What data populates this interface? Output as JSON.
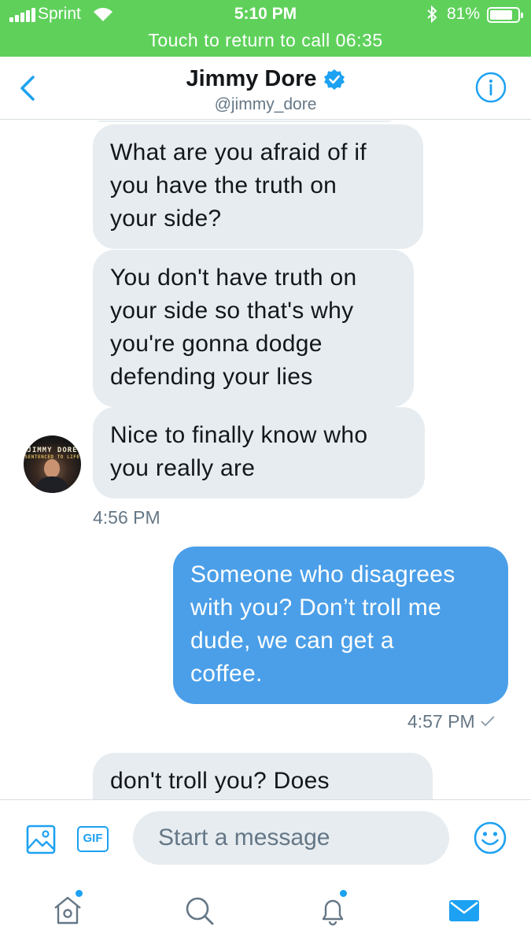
{
  "status_bar": {
    "carrier": "Sprint",
    "time": "5:10 PM",
    "battery_percent": "81%",
    "battery_level": 0.81,
    "call_banner": "Touch to return to call 06:35",
    "background_color": "#5fd15b"
  },
  "header": {
    "display_name": "Jimmy Dore",
    "handle": "@jimmy_dore",
    "verified": true,
    "accent_color": "#1da1f2"
  },
  "conversation": {
    "incoming": [
      {
        "lines": [
          "What are you afraid of if",
          "you have the truth on",
          "your side?"
        ]
      },
      {
        "lines": [
          "You don't have truth on",
          "your side so that's why",
          "you're gonna dodge",
          "defending your lies"
        ]
      },
      {
        "lines": [
          "Nice to finally know who",
          "you really are"
        ]
      }
    ],
    "avatar_text": "JIMMY DORE",
    "avatar_subtext": "SENTENCED TO LIFE",
    "incoming_timestamp": "4:56 PM",
    "outgoing": {
      "lines": [
        "Someone who disagrees",
        "with you? Don’t troll me",
        "dude, we can get a",
        "coffee."
      ],
      "timestamp": "4:57 PM",
      "status_icon": "check-icon"
    },
    "partial": {
      "lines": [
        "don't troll you? Does"
      ]
    },
    "incoming_bubble_color": "#e6ecf0",
    "outgoing_bubble_color": "#4b9fe8"
  },
  "composer": {
    "gif_label": "GIF",
    "placeholder": "Start a message"
  },
  "tabs": [
    {
      "icon": "home-icon",
      "has_dot": true
    },
    {
      "icon": "search-icon",
      "has_dot": false
    },
    {
      "icon": "notifications-icon",
      "has_dot": true
    },
    {
      "icon": "messages-icon",
      "active": true,
      "has_dot": false
    }
  ]
}
